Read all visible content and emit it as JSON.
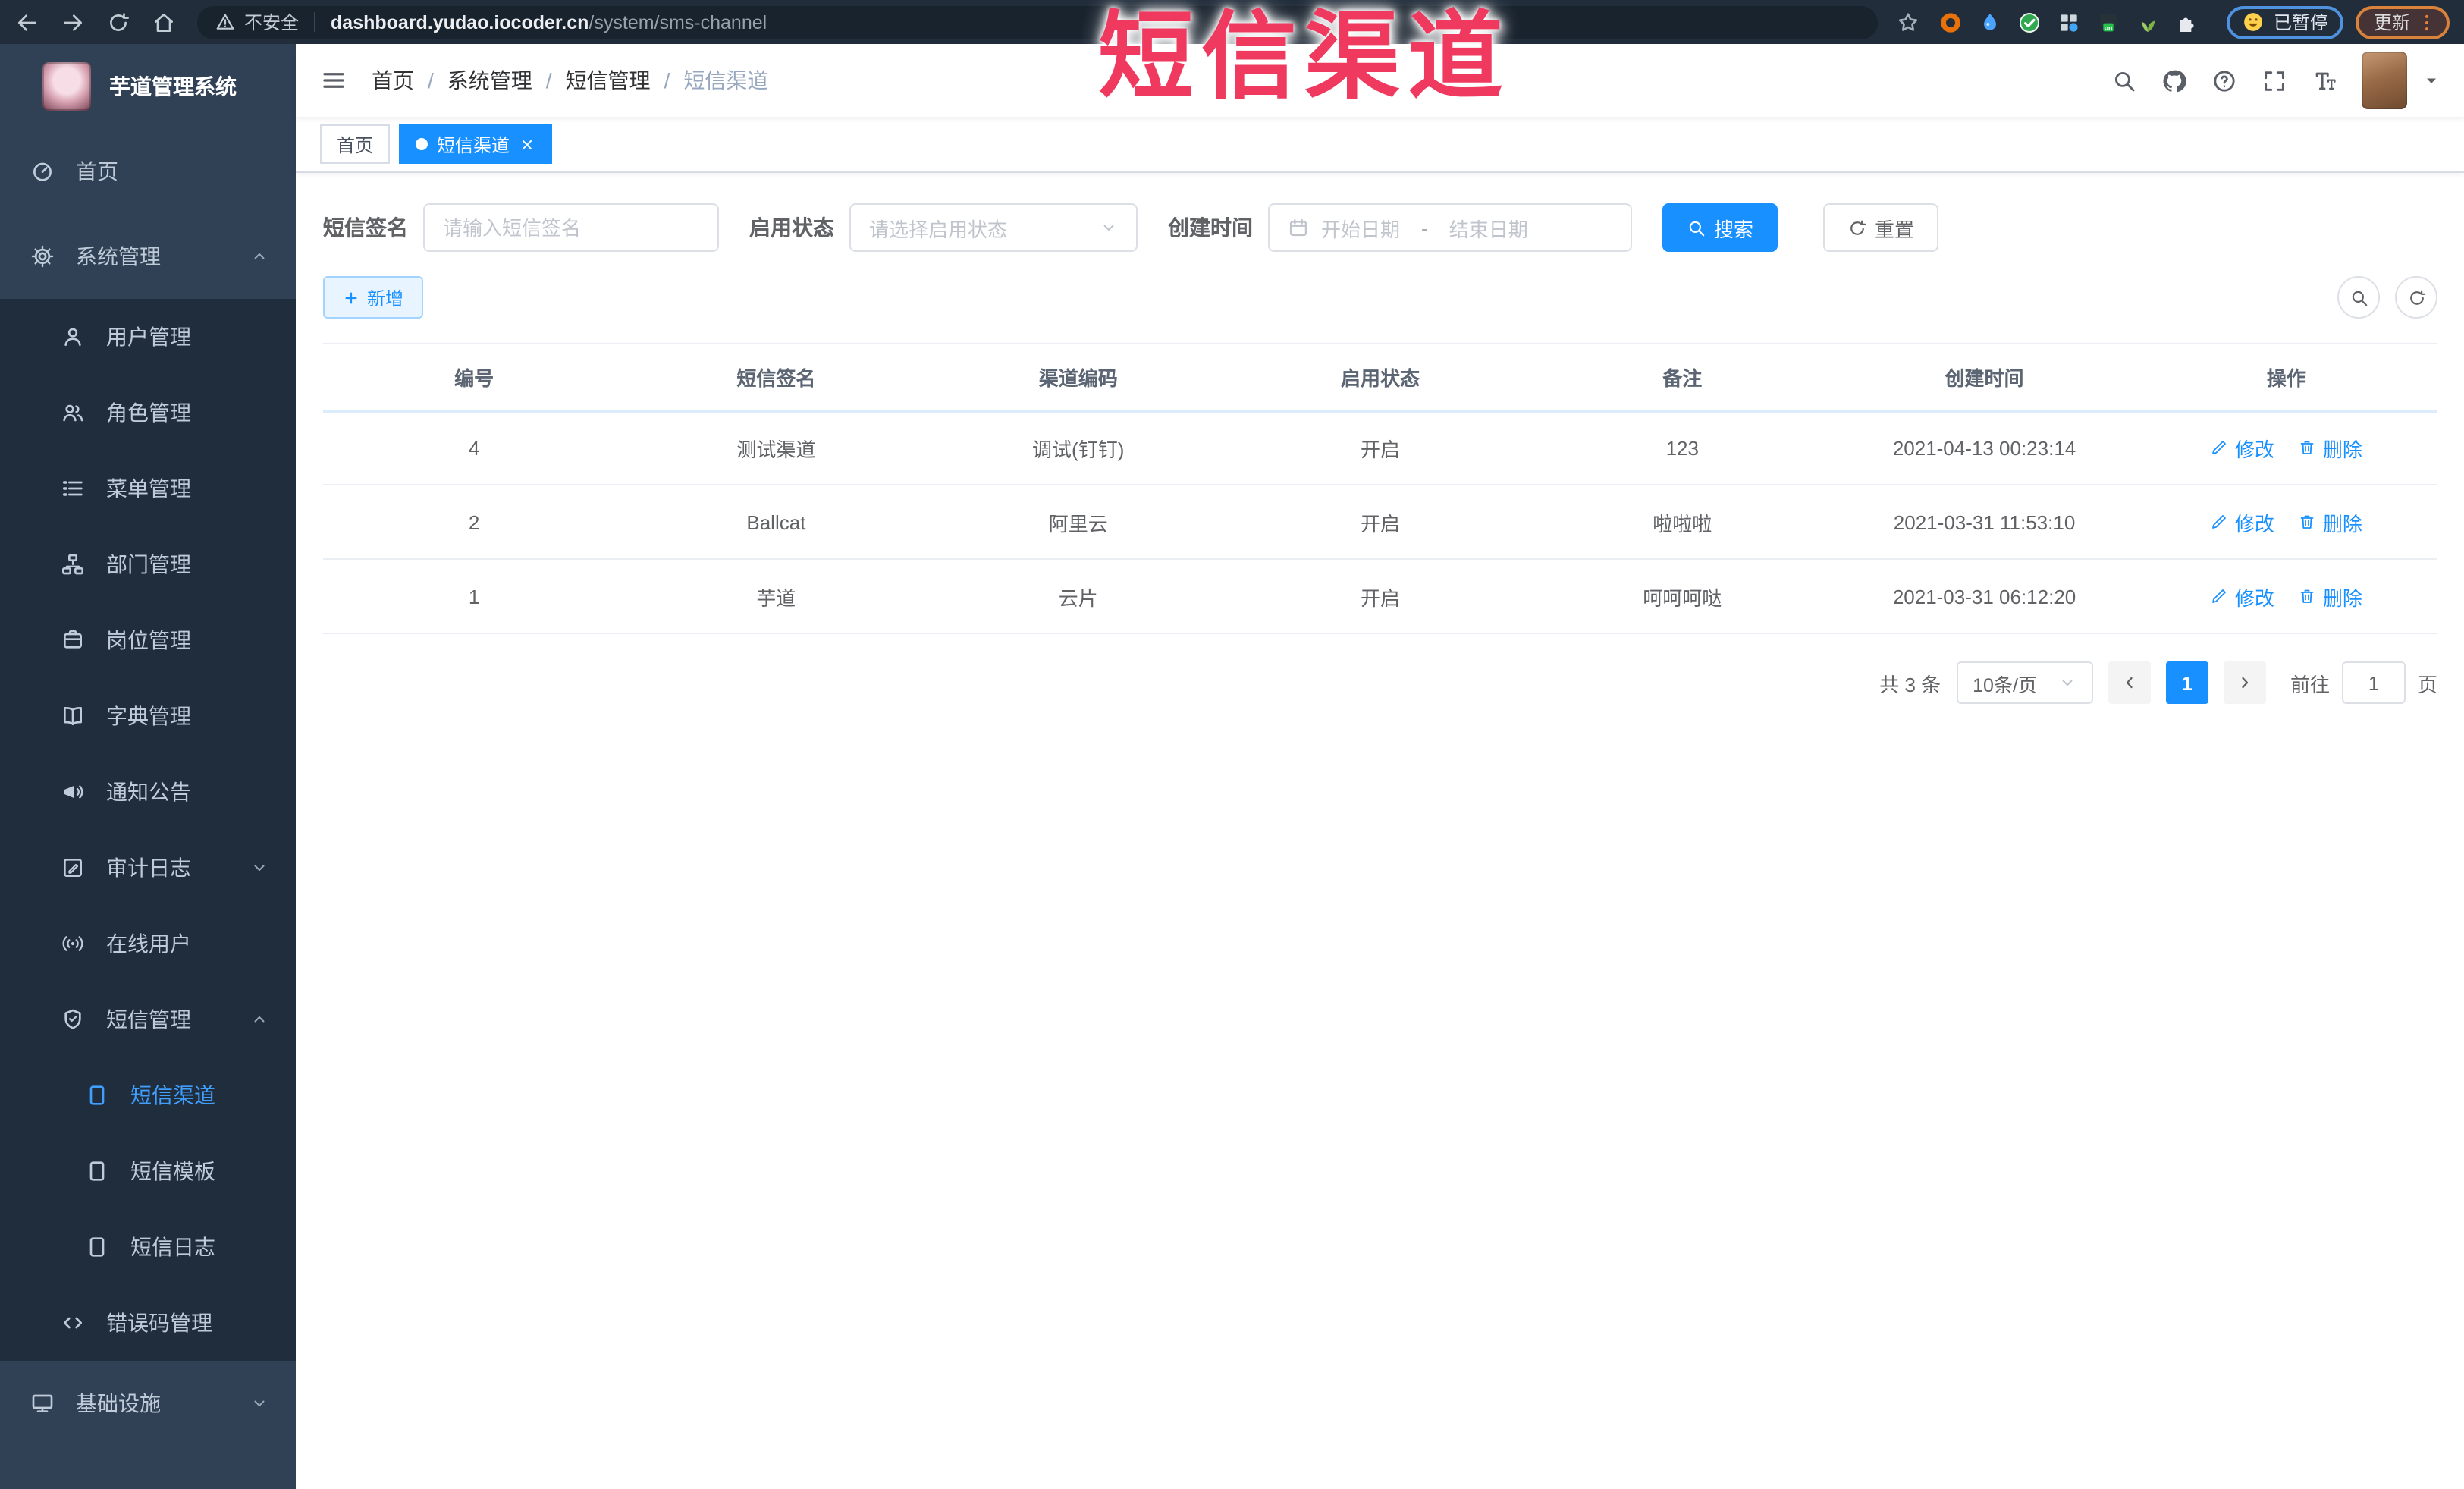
{
  "theme": {
    "primary": "#1890ff",
    "sidebar_bg": "#304156",
    "sidebar_sub_bg": "#1f2d3d",
    "active_blue": "#409eff",
    "overlay_red": "#f0395f"
  },
  "overlay": {
    "title": "短信渠道"
  },
  "browser": {
    "security_label": "不安全",
    "url_host": "dashboard.yudao.iocoder.cn",
    "url_path": "/system/sms-channel",
    "paused_label": "已暂停",
    "update_label": "更新",
    "extensions": [
      "ring-icon",
      "drop-icon",
      "check-circle-icon",
      "grid-icon",
      "on-badge-icon",
      "sprout-icon",
      "puzzle-icon"
    ]
  },
  "sidebar": {
    "logo_title": "芋道管理系统",
    "items": [
      {
        "key": "home",
        "label": "首页",
        "icon": "dashboard-icon",
        "level": 1
      },
      {
        "key": "system",
        "label": "系统管理",
        "icon": "gear-icon",
        "level": 1,
        "chevron": "up"
      },
      {
        "key": "user",
        "label": "用户管理",
        "icon": "user-icon",
        "level": 2
      },
      {
        "key": "role",
        "label": "角色管理",
        "icon": "users-icon",
        "level": 2
      },
      {
        "key": "menu",
        "label": "菜单管理",
        "icon": "list-icon",
        "level": 2
      },
      {
        "key": "dept",
        "label": "部门管理",
        "icon": "tree-icon",
        "level": 2
      },
      {
        "key": "post",
        "label": "岗位管理",
        "icon": "badge-icon",
        "level": 2
      },
      {
        "key": "dict",
        "label": "字典管理",
        "icon": "book-icon",
        "level": 2
      },
      {
        "key": "notice",
        "label": "通知公告",
        "icon": "megaphone-icon",
        "level": 2
      },
      {
        "key": "audit-log",
        "label": "审计日志",
        "icon": "log-icon",
        "level": 2,
        "chevron": "down"
      },
      {
        "key": "online-user",
        "label": "在线用户",
        "icon": "online-icon",
        "level": 2
      },
      {
        "key": "sms",
        "label": "短信管理",
        "icon": "shield-icon",
        "level": 2,
        "chevron": "up"
      },
      {
        "key": "sms-channel",
        "label": "短信渠道",
        "icon": "square-icon",
        "level": 3,
        "active": true
      },
      {
        "key": "sms-template",
        "label": "短信模板",
        "icon": "square-icon",
        "level": 3
      },
      {
        "key": "sms-log",
        "label": "短信日志",
        "icon": "square-icon",
        "level": 3
      },
      {
        "key": "error-code",
        "label": "错误码管理",
        "icon": "code-icon",
        "level": 2
      },
      {
        "key": "infra",
        "label": "基础设施",
        "icon": "monitor-icon",
        "level": 1,
        "chevron": "down"
      }
    ]
  },
  "header": {
    "breadcrumb": [
      "首页",
      "系统管理",
      "短信管理",
      "短信渠道"
    ]
  },
  "tabs": [
    {
      "label": "首页",
      "active": false
    },
    {
      "label": "短信渠道",
      "active": true,
      "closable": true
    }
  ],
  "filters": {
    "sign_label": "短信签名",
    "sign_placeholder": "请输入短信签名",
    "status_label": "启用状态",
    "status_placeholder": "请选择启用状态",
    "time_label": "创建时间",
    "start_placeholder": "开始日期",
    "range_separator": "-",
    "end_placeholder": "结束日期",
    "search_label": "搜索",
    "reset_label": "重置"
  },
  "toolbar": {
    "add_label": "新增"
  },
  "table": {
    "columns": [
      "编号",
      "短信签名",
      "渠道编码",
      "启用状态",
      "备注",
      "创建时间",
      "操作"
    ],
    "edit_label": "修改",
    "delete_label": "删除",
    "rows": [
      {
        "id": "4",
        "sign": "测试渠道",
        "code": "调试(钉钉)",
        "status": "开启",
        "remark": "123",
        "created": "2021-04-13 00:23:14"
      },
      {
        "id": "2",
        "sign": "Ballcat",
        "code": "阿里云",
        "status": "开启",
        "remark": "啦啦啦",
        "created": "2021-03-31 11:53:10"
      },
      {
        "id": "1",
        "sign": "芋道",
        "code": "云片",
        "status": "开启",
        "remark": "呵呵呵哒",
        "created": "2021-03-31 06:12:20"
      }
    ]
  },
  "pagination": {
    "total_label": "共 3 条",
    "page_size": "10条/页",
    "current_page": "1",
    "goto_label": "前往",
    "goto_value": "1",
    "page_label": "页"
  }
}
